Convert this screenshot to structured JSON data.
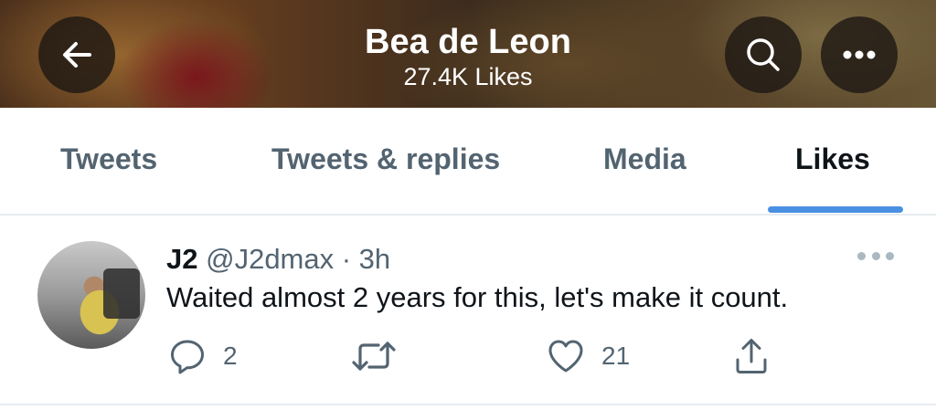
{
  "header": {
    "title": "Bea de Leon",
    "subtitle": "27.4K Likes",
    "icons": {
      "back": "arrow-left-icon",
      "search": "search-icon",
      "more": "more-horizontal-icon"
    }
  },
  "tabs": [
    {
      "label": "Tweets",
      "active": false
    },
    {
      "label": "Tweets & replies",
      "active": false
    },
    {
      "label": "Media",
      "active": false
    },
    {
      "label": "Likes",
      "active": true
    }
  ],
  "colors": {
    "accent": "#4a90e2",
    "secondary_text": "#536471",
    "divider": "#e6ecf0"
  },
  "tweet": {
    "author_name": "J2",
    "meta": "@J2dmax · 3h",
    "text": "Waited almost 2 years for this, let's make it count.",
    "reply_count": "2",
    "retweet_count": "",
    "like_count": "21",
    "icons": {
      "reply": "reply-icon",
      "retweet": "retweet-icon",
      "like": "heart-icon",
      "share": "share-icon",
      "more": "more-horizontal-icon"
    }
  }
}
